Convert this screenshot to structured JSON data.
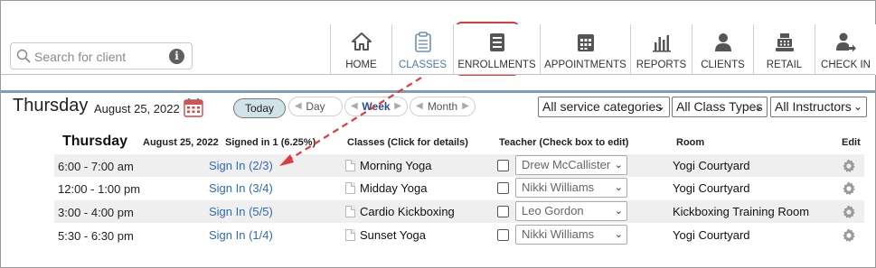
{
  "search": {
    "placeholder": "Search for client"
  },
  "nav": [
    {
      "label": "HOME",
      "icon": "home-icon",
      "active": false
    },
    {
      "label": "CLASSES",
      "icon": "clipboard-icon",
      "active": true
    },
    {
      "label": "ENROLLMENTS",
      "icon": "enrollments-icon",
      "active": false
    },
    {
      "label": "APPOINTMENTS",
      "icon": "calendar-grid-icon",
      "active": false
    },
    {
      "label": "REPORTS",
      "icon": "bar-chart-icon",
      "active": false
    },
    {
      "label": "CLIENTS",
      "icon": "person-icon",
      "active": false
    },
    {
      "label": "RETAIL",
      "icon": "cash-register-icon",
      "active": false
    },
    {
      "label": "CHECK IN",
      "icon": "check-in-icon",
      "active": false
    }
  ],
  "header": {
    "day": "Thursday",
    "date": "August 25, 2022",
    "today_label": "Today",
    "view_day": "Day",
    "view_week": "Week",
    "view_month": "Month",
    "filter_service": "All service categories",
    "filter_class_types": "All Class Types",
    "filter_instructors": "All Instructors"
  },
  "table": {
    "day": "Thursday",
    "date": "August 25, 2022",
    "signed_in": "Signed in 1 (6.25%)",
    "col_classes": "Classes (Click for details)",
    "col_teacher": "Teacher (Check box to edit)",
    "col_room": "Room",
    "col_edit": "Edit",
    "rows": [
      {
        "time": "6:00 - 7:00 am",
        "signin": "Sign In (2/3)",
        "class": "Morning Yoga",
        "teacher": "Drew McCallister",
        "room": "Yogi Courtyard"
      },
      {
        "time": "12:00 - 1:00 pm",
        "signin": "Sign In (3/4)",
        "class": "Midday Yoga",
        "teacher": "Nikki Williams",
        "room": "Yogi Courtyard"
      },
      {
        "time": "3:00 - 4:00 pm",
        "signin": "Sign In (5/5)",
        "class": "Cardio Kickboxing",
        "teacher": "Leo Gordon",
        "room": "Kickboxing Training Room"
      },
      {
        "time": "5:30 - 6:30 pm",
        "signin": "Sign In (1/4)",
        "class": "Sunset Yoga",
        "teacher": "Nikki Williams",
        "room": "Yogi Courtyard"
      }
    ]
  },
  "colors": {
    "accent": "#2f6db5",
    "highlight": "#e0393e",
    "divider": "#7f9cb6"
  }
}
